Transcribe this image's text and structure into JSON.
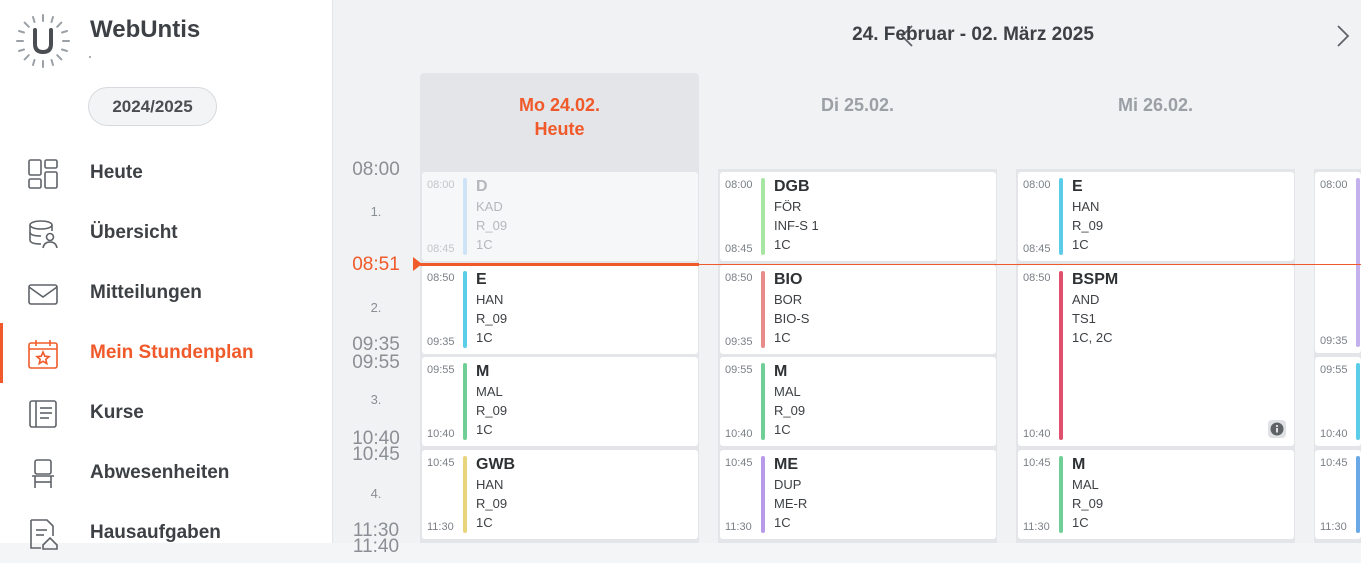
{
  "app": {
    "name": "WebUntis",
    "school_year": "2024/2025"
  },
  "nav": [
    {
      "label": "Heute",
      "icon": "dashboard-icon"
    },
    {
      "label": "Übersicht",
      "icon": "overview-icon"
    },
    {
      "label": "Mitteilungen",
      "icon": "envelope-icon"
    },
    {
      "label": "Mein Stundenplan",
      "icon": "calendar-star-icon",
      "active": true
    },
    {
      "label": "Kurse",
      "icon": "book-icon"
    },
    {
      "label": "Abwesenheiten",
      "icon": "chair-icon"
    },
    {
      "label": "Hausaufgaben",
      "icon": "homework-icon"
    }
  ],
  "header": {
    "date_range": "24. Februar - 02. März 2025"
  },
  "days": [
    {
      "label": "Mo 24.02.",
      "sub": "Heute",
      "today": true
    },
    {
      "label": "Di 25.02.",
      "sub": ""
    },
    {
      "label": "Mi 26.02.",
      "sub": ""
    }
  ],
  "times": {
    "t0800": "08:00",
    "p1": "1.",
    "now": "08:51",
    "p2": "2.",
    "t0935": "09:35",
    "t0955": "09:55",
    "p3": "3.",
    "t1040": "10:40",
    "t1045": "10:45",
    "p4": "4.",
    "t1130": "11:30",
    "t1140": "11:40"
  },
  "lessons": {
    "mo1": {
      "start": "08:00",
      "end": "08:45",
      "subject": "D",
      "teacher": "KAD",
      "room": "R_09",
      "class": "1C",
      "color": "#a9cff2"
    },
    "mo2": {
      "start": "08:50",
      "end": "09:35",
      "subject": "E",
      "teacher": "HAN",
      "room": "R_09",
      "class": "1C",
      "color": "#5ccde8"
    },
    "mo3": {
      "start": "09:55",
      "end": "10:40",
      "subject": "M",
      "teacher": "MAL",
      "room": "R_09",
      "class": "1C",
      "color": "#6fcf97"
    },
    "mo4": {
      "start": "10:45",
      "end": "11:30",
      "subject": "GWB",
      "teacher": "HAN",
      "room": "R_09",
      "class": "1C",
      "color": "#e8d47a"
    },
    "di1": {
      "start": "08:00",
      "end": "08:45",
      "subject": "DGB",
      "teacher": "FÖR",
      "room": "INF-S 1",
      "class": "1C",
      "color": "#a8e6a3"
    },
    "di2": {
      "start": "08:50",
      "end": "09:35",
      "subject": "BIO",
      "teacher": "BOR",
      "room": "BIO-S",
      "class": "1C",
      "color": "#e88b8b"
    },
    "di3": {
      "start": "09:55",
      "end": "10:40",
      "subject": "M",
      "teacher": "MAL",
      "room": "R_09",
      "class": "1C",
      "color": "#6fcf97"
    },
    "di4": {
      "start": "10:45",
      "end": "11:30",
      "subject": "ME",
      "teacher": "DUP",
      "room": "ME-R",
      "class": "1C",
      "color": "#b89be8"
    },
    "mi1": {
      "start": "08:00",
      "end": "08:45",
      "subject": "E",
      "teacher": "HAN",
      "room": "R_09",
      "class": "1C",
      "color": "#5ccde8"
    },
    "mi2": {
      "start": "08:50",
      "end": "10:40",
      "subject": "BSPM",
      "teacher": "AND",
      "room": "TS1",
      "class": "1C, 2C",
      "color": "#e0506e"
    },
    "mi4": {
      "start": "10:45",
      "end": "11:30",
      "subject": "M",
      "teacher": "MAL",
      "room": "R_09",
      "class": "1C",
      "color": "#6fcf97"
    },
    "do1": {
      "start": "08:00",
      "color": "#c4b0ec"
    },
    "do2": {
      "end": "09:35"
    },
    "do3": {
      "start": "09:55",
      "end": "10:40",
      "color": "#5ccde8"
    },
    "do4": {
      "start": "10:45",
      "end": "11:30",
      "color": "#6aa8e8"
    }
  },
  "colors": {
    "accent": "#f05a2a"
  }
}
